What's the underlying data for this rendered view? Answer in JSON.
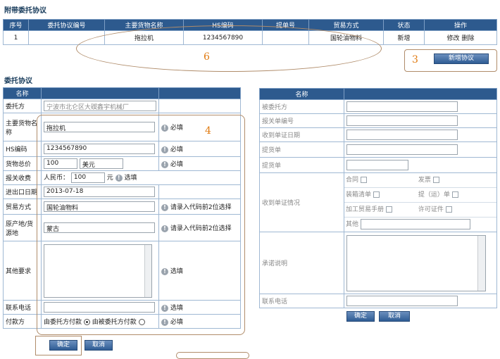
{
  "attached": {
    "title": "附带委托协议",
    "headers": [
      "序号",
      "委托协议编号",
      "主要货物名称",
      "HS编码",
      "提单号",
      "贸易方式",
      "状态",
      "操作"
    ],
    "row": {
      "no": "1",
      "agreement_no": "",
      "goods": "拖拉机",
      "hs": "1234567890",
      "bill": "",
      "trade": "国轮油物料",
      "status": "新增",
      "edit": "修改",
      "delete": "删除"
    },
    "add_button": "新增协议"
  },
  "entrust": {
    "title": "委托协议",
    "left_header": "名称",
    "labels": {
      "client": "委托方",
      "goods": "主要货物名称",
      "hs": "HS编码",
      "total": "货物总价",
      "fee": "报关收费",
      "date": "进出口日期",
      "trade": "贸易方式",
      "origin": "原产地/货源地",
      "other": "其他要求",
      "phone": "联系电话",
      "payer": "付款方"
    },
    "values": {
      "client": "宁波市北仑区大碶鑫宇机械厂",
      "goods": "拖拉机",
      "hs": "1234567890",
      "total_amount": "100",
      "total_currency": "美元",
      "fee_prefix": "人民币：",
      "fee_amount": "100",
      "fee_unit": "元",
      "date": "2013-07-18",
      "trade": "国轮油物料",
      "origin": "蒙古"
    },
    "hints": {
      "goods": "必填",
      "hs": "必填",
      "total": "必填",
      "fee": "选填",
      "trade": "请录入代码前2位选择",
      "origin": "请录入代码前2位选择",
      "other": "选填",
      "phone": "选填",
      "payer": "必填"
    },
    "payer_options": [
      "由委托方付款",
      "由被委托方付款"
    ],
    "payer_selected": 0,
    "confirm": "确定",
    "cancel": "取消"
  },
  "right": {
    "header": "名称",
    "labels": {
      "entrusted": "被委托方",
      "decl_no": "报关单编号",
      "recv_date": "收到单证日期",
      "bill": "提货单",
      "bill2": "提货单",
      "docs": "收到单证情况",
      "promise": "承诺说明",
      "phone": "联系电话"
    },
    "docs": {
      "contract": "合同",
      "invoice": "发票",
      "packing": "装箱清单",
      "lading": "提（运）单",
      "handbook": "加工贸易手册",
      "license": "许可证件",
      "other": "其他"
    },
    "confirm": "确定",
    "cancel": "取消"
  },
  "annotations": {
    "n3": "3",
    "n4": "4",
    "n6": "6"
  }
}
